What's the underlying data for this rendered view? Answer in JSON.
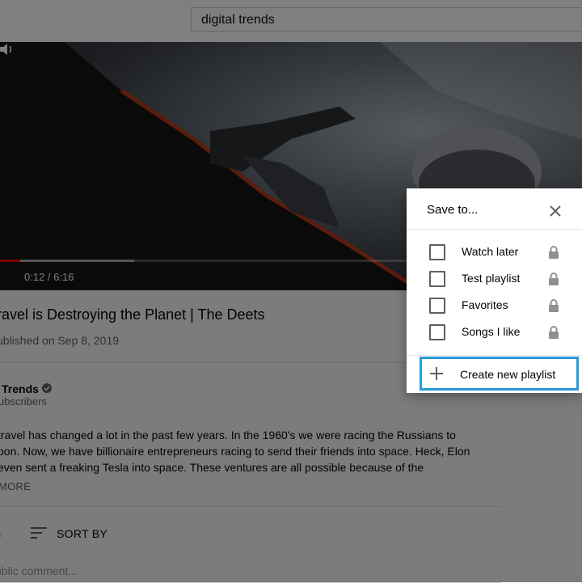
{
  "search": {
    "value": "digital trends"
  },
  "player": {
    "time": "0:12 / 6:16",
    "progress_played": 0.035,
    "progress_buffered": 0.23
  },
  "video": {
    "title": "ravel is Destroying the Planet | The Deets",
    "published": "ublished on Sep 8, 2019"
  },
  "channel": {
    "name": "Trends",
    "subscribers": "ubscribers"
  },
  "description": {
    "lines": [
      "travel has changed a lot in the past few years. In the 1960's we were racing the Russians to",
      "oon. Now, we have billionaire entrepreneurs racing to send their friends into space. Heck, Elon",
      "even sent a freaking Tesla into space. These ventures are all possible because of the"
    ],
    "show_more": "MORE"
  },
  "comments": {
    "count_label": "s",
    "sort_label": "SORT BY",
    "input_placeholder": "ublic comment..."
  },
  "dialog": {
    "title": "Save to...",
    "close_icon": "close-icon",
    "playlists": [
      {
        "label": "Watch later",
        "checked": false,
        "icon": "lock-icon"
      },
      {
        "label": "Test playlist",
        "checked": false,
        "icon": "lock-icon"
      },
      {
        "label": "Favorites",
        "checked": false,
        "icon": "lock-icon"
      },
      {
        "label": "Songs I like",
        "checked": false,
        "icon": "lock-icon"
      }
    ],
    "create_label": "Create new playlist",
    "create_icon": "plus-icon",
    "highlight_color": "#2c9ad8"
  },
  "colors": {
    "overlay": "rgba(0,0,0,0.5)",
    "progress": "#ff0000"
  }
}
